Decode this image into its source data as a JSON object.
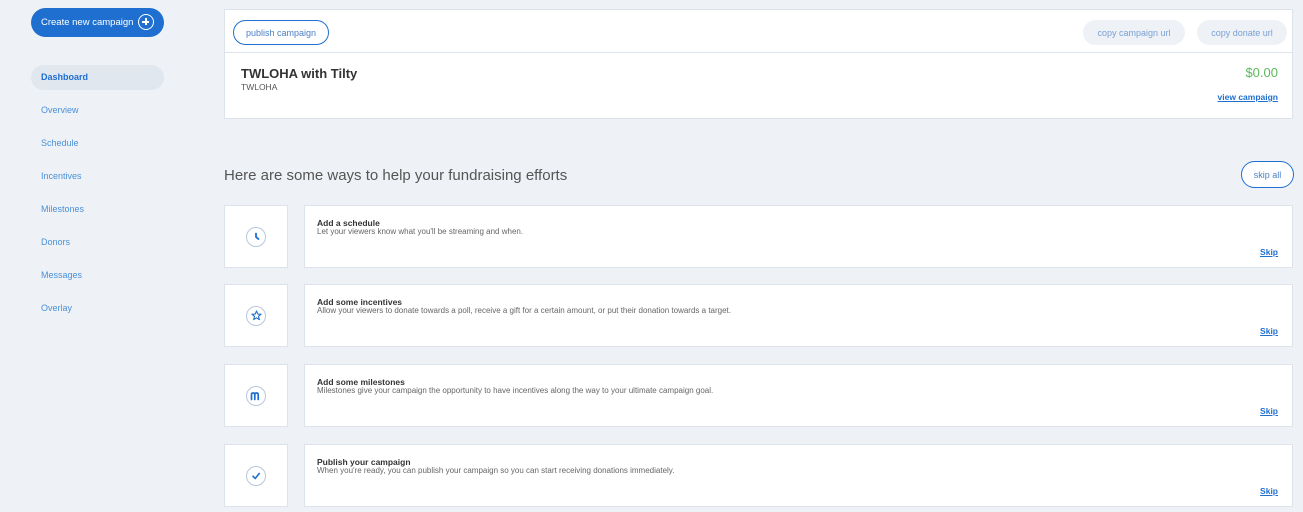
{
  "sidebar": {
    "create_button": "Create new campaign",
    "items": [
      {
        "label": "Dashboard"
      },
      {
        "label": "Overview"
      },
      {
        "label": "Schedule"
      },
      {
        "label": "Incentives"
      },
      {
        "label": "Milestones"
      },
      {
        "label": "Donors"
      },
      {
        "label": "Messages"
      },
      {
        "label": "Overlay"
      }
    ],
    "active_item": "Dashboard"
  },
  "toolbar": {
    "publish_label": "publish campaign",
    "copy_campaign_label": "copy campaign url",
    "copy_donate_label": "copy donate url"
  },
  "campaign": {
    "title": "TWLOHA with Tilty",
    "subtitle": "TWLOHA",
    "amount": "$0.00",
    "view_link": "view campaign"
  },
  "help": {
    "title": "Here are some ways to help your fundraising efforts",
    "skip_all": "skip all",
    "steps": [
      {
        "title": "Add a schedule",
        "description": "Let your viewers know what you'll be streaming and when.",
        "skip": "Skip",
        "icon": "clock-icon"
      },
      {
        "title": "Add some incentives",
        "description": "Allow your viewers to donate towards a poll, receive a gift for a certain amount, or put their donation towards a target.",
        "skip": "Skip",
        "icon": "star-icon"
      },
      {
        "title": "Add some milestones",
        "description": "Milestones give your campaign the opportunity to have incentives along the way to your ultimate campaign goal.",
        "skip": "Skip",
        "icon": "milestone-m-icon"
      },
      {
        "title": "Publish your campaign",
        "description": "When you're ready, you can publish your campaign so you can start receiving donations immediately.",
        "skip": "Skip",
        "icon": "checkmark-icon"
      }
    ]
  },
  "colors": {
    "accent": "#1e6fd0",
    "amount": "#5cb85c",
    "background": "#eef1f5"
  }
}
